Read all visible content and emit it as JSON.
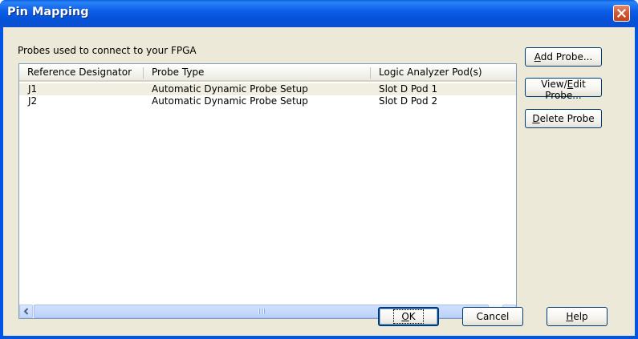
{
  "window": {
    "title": "Pin Mapping"
  },
  "group": {
    "label": "Probes used to connect to your FPGA"
  },
  "table": {
    "columns": [
      "Reference Designator",
      "Probe Type",
      "Logic Analyzer Pod(s)"
    ],
    "rows": [
      [
        "J1",
        "Automatic Dynamic Probe Setup",
        "Slot D Pod 1"
      ],
      [
        "J2",
        "Automatic Dynamic Probe Setup",
        "Slot D Pod 2"
      ]
    ]
  },
  "side_buttons": {
    "add_probe": {
      "accel": "A",
      "rest": "dd Probe..."
    },
    "view_edit_probe": {
      "pre": "View/",
      "accel": "E",
      "rest": "dit Probe..."
    },
    "delete_probe": {
      "accel": "D",
      "rest": "elete Probe"
    }
  },
  "bottom_buttons": {
    "ok": {
      "accel": "O",
      "rest": "K"
    },
    "cancel": {
      "label": "Cancel"
    },
    "help": {
      "accel": "H",
      "rest": "elp"
    }
  },
  "colors": {
    "titlebar": "#0552d8",
    "client": "#ece9d8",
    "selected_row": "#f1efe2",
    "close_button": "#d55a32"
  },
  "icons": {
    "close": "close-icon",
    "scroll_left": "chevron-left-icon",
    "scroll_right": "chevron-right-icon",
    "scroll_grip": "grip-icon"
  }
}
